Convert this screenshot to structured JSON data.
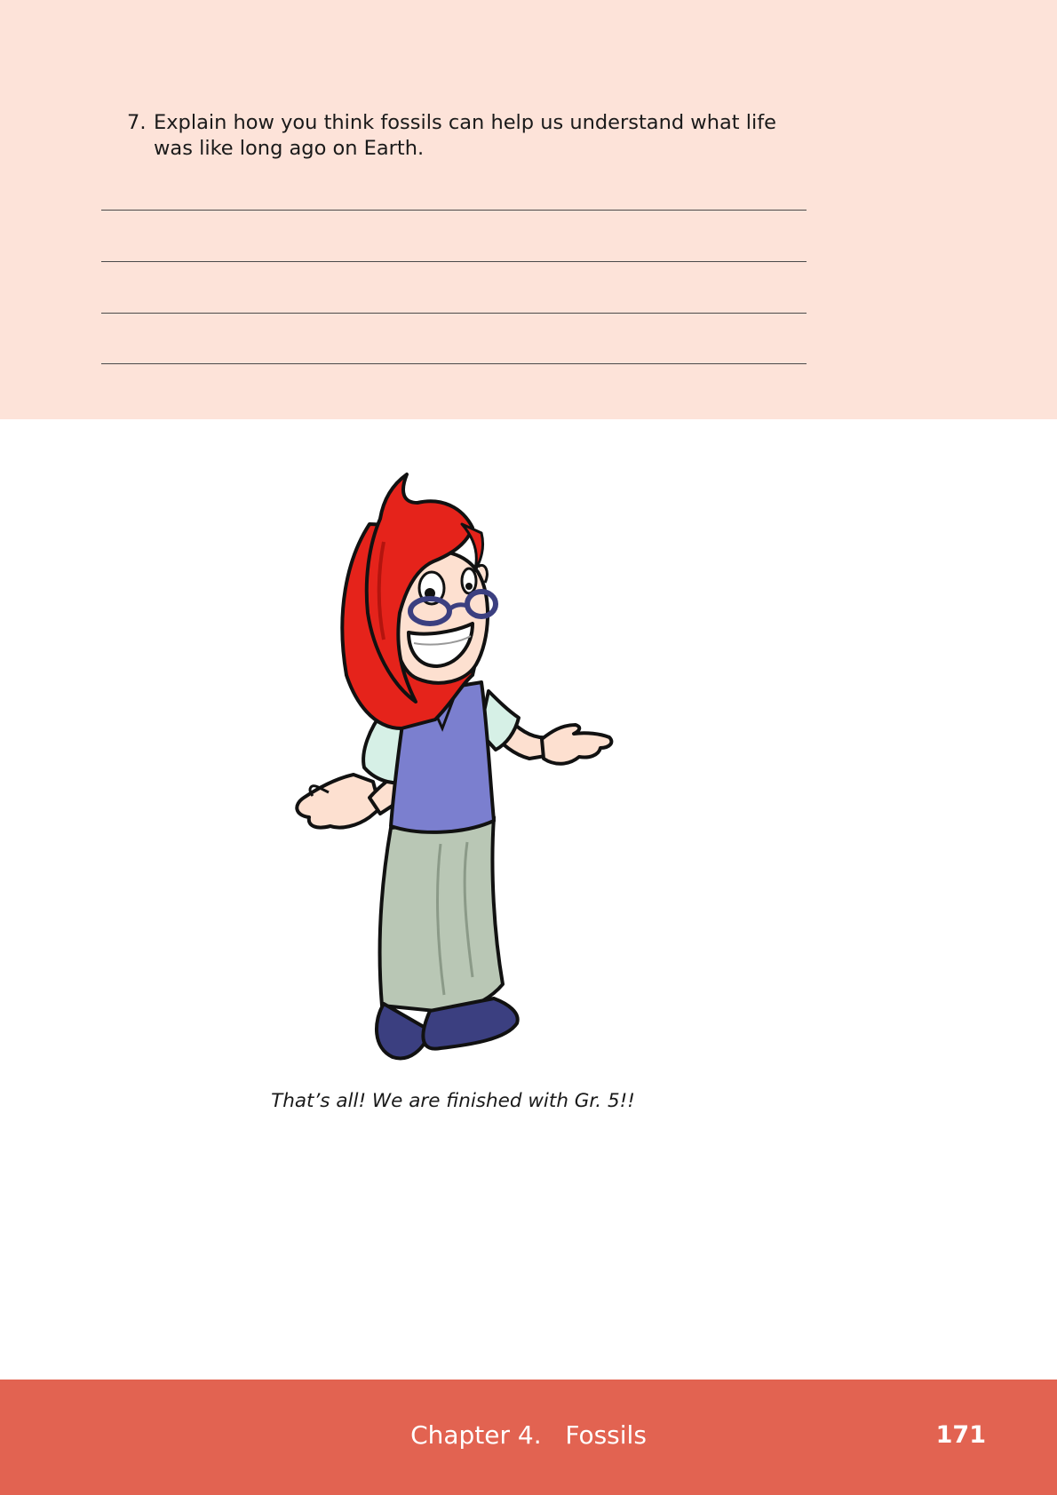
{
  "question": {
    "number": "7.",
    "text": "Explain how you think fossils can help us understand what life was like long ago on Earth.",
    "answer_lines": 4
  },
  "illustration": {
    "subject": "cartoon girl with red hair and glasses shrugging",
    "icon": "character-illustration"
  },
  "caption": "That’s all! We are finished with Gr. 5!!",
  "footer": {
    "chapter": "Chapter 4.   Fossils",
    "page_number": "171"
  },
  "colors": {
    "panel_background": "#fde3d9",
    "footer_background": "#e26351",
    "hair": "#e5231b",
    "vest": "#7b7fcf",
    "shirt": "#d6f0e6",
    "skirt": "#b9c7b5",
    "shoes": "#3b3f80",
    "skin": "#fde0d0"
  }
}
